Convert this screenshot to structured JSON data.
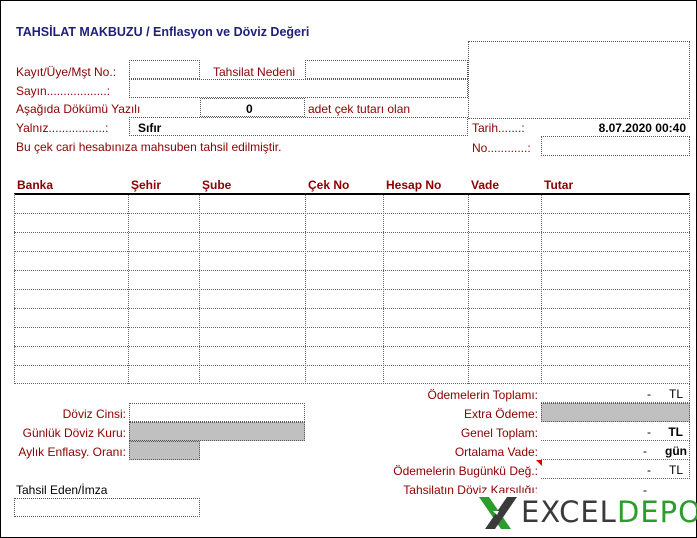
{
  "form": {
    "title": "TAHSİLAT MAKBUZU / Enflasyon ve Döviz Değeri",
    "kayit_label": "Kayıt/Üye/Mşt No.:",
    "tahsilat_nedeni_label": "Tahsilat Nedeni",
    "sayin_label": "Sayın..................:",
    "asagida_label": "Aşağıda Dökümü Yazılı",
    "cek_count": "0",
    "adet_label": "adet çek tutarı olan",
    "yalniz_label": "Yalnız.................:",
    "yalniz_value": "Sıfır",
    "tarih_label": "Tarih.......:",
    "tarih_value": "8.07.2020 00:40",
    "mahsuben_text": "Bu çek cari hesabınıza mahsuben tahsil edilmiştir.",
    "no_label": "No............:"
  },
  "table": {
    "columns": [
      "Banka",
      "Şehir",
      "Şube",
      "Çek No",
      "Hesap No",
      "Vade",
      "Tutar"
    ]
  },
  "totals": {
    "odemelerin_toplami_label": "Ödemelerin Toplamı:",
    "odemelerin_toplami_value": "-",
    "odemelerin_toplami_unit": "TL",
    "extra_odeme_label": "Extra Ödeme:",
    "genel_toplam_label": "Genel Toplam:",
    "genel_toplam_value": "-",
    "genel_toplam_unit": "TL",
    "ortalama_vade_label": "Ortalama Vade:",
    "ortalama_vade_value": "-",
    "ortalama_vade_unit": "gün",
    "bugunku_label": "Ödemelerin Bugünkü Değ.:",
    "bugunku_value": "-",
    "bugunku_unit": "TL",
    "doviz_karsiligi_label": "Tahsilatın Döviz Karşılığı:",
    "doviz_karsiligi_value": "-"
  },
  "currency": {
    "doviz_cinsi_label": "Döviz Cinsi:",
    "gunluk_kur_label": "Günlük Döviz Kuru:",
    "aylik_enflasyon_label": "Aylık Enflasy. Oranı:"
  },
  "signature": {
    "label": "Tahsil Eden/İmza"
  },
  "logo": {
    "text_excel": "EXCEL",
    "text_depo": "DEPO",
    "color_dark": "#3a3a3a",
    "color_green": "#2a9d2a"
  }
}
